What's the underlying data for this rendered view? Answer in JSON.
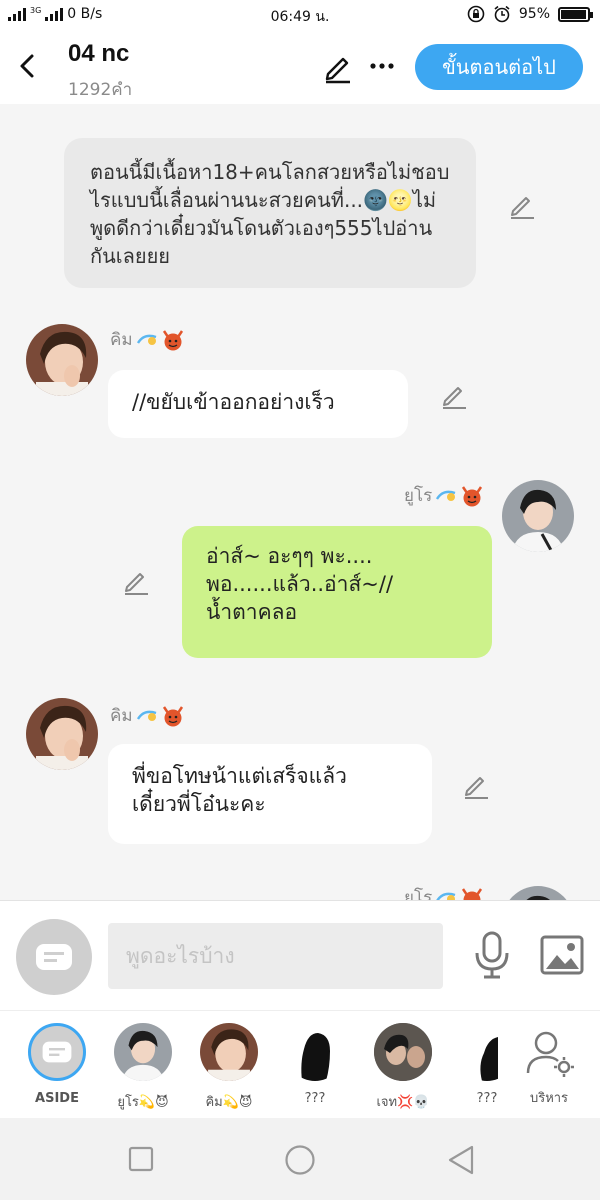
{
  "status_bar": {
    "network": "0 B/s",
    "carrier_tag": "3G",
    "time": "06:49 น.",
    "battery_text": "95%",
    "battery_level": 0.95
  },
  "header": {
    "title": "04 nc",
    "word_count": "1292คำ",
    "next_button": "ขั้นตอนต่อไป"
  },
  "messages": {
    "narration": "ตอนนี้มีเนื้อหา18+คนโลกสวยหรือไม่ชอบไรแบบนี้เลื่อนผ่านนะสวยคนที่...🌚🌝ไม่พูดดีกว่าเดี๋ยวมันโดนตัวเองๆ555ไปอ่านกันเลยยย",
    "m1_name": "คิม",
    "m1_text": "//ขยับเข้าออกอย่างเร็ว",
    "m2_name": "ยูโร",
    "m2_text": "อ่าส์~ อะๆๆ  พะ....\nพอ......แล้ว..อ่าส์~//\nน้ำตาคลอ",
    "m3_name": "คิม",
    "m3_text": "พี่ขอโทษน้าแต่เสร็จแล้ว\nเดี๋ยวพี่โอ๋นะคะ",
    "m4_name": "ยูโร"
  },
  "input": {
    "placeholder": "พูดอะไรบ้าง"
  },
  "characters": [
    {
      "label": "ASIDE"
    },
    {
      "label": "ยูโร"
    },
    {
      "label": "คิม"
    },
    {
      "label": "???"
    },
    {
      "label": "เจท"
    },
    {
      "label": "???"
    },
    {
      "label": "บริหาร"
    }
  ],
  "colors": {
    "accent": "#3da7f2",
    "green_bubble": "#cdf28b",
    "narration_bg": "#e9e9e9"
  }
}
